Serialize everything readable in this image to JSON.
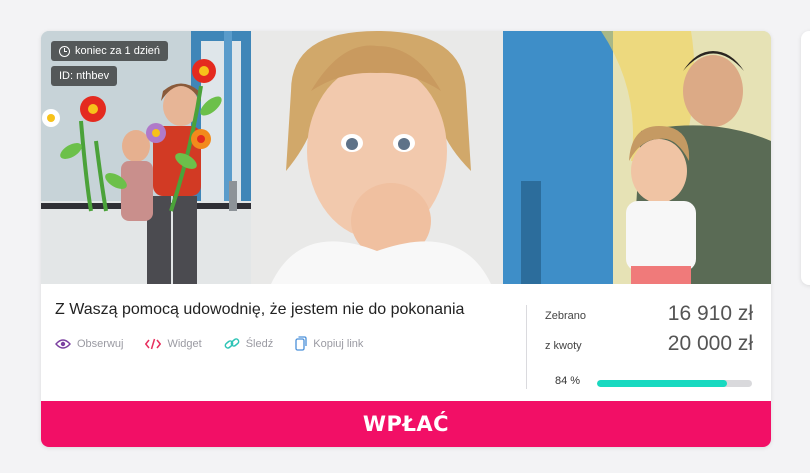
{
  "campaign": {
    "deadline": "koniec za 1 dzień",
    "id_label": "ID: nthbev",
    "title": "Z Waszą pomocą udowodnię, że jestem nie do pokonania",
    "actions": [
      {
        "label": "Obserwuj",
        "icon": "eye-icon"
      },
      {
        "label": "Widget",
        "icon": "code-icon"
      },
      {
        "label": "Śledź",
        "icon": "link-icon"
      },
      {
        "label": "Kopiuj link",
        "icon": "copy-icon"
      }
    ],
    "raised_label": "Zebrano",
    "raised_value": "16 910 zł",
    "goal_label": "z kwoty",
    "goal_value": "20 000 zł",
    "progress_text": "84 %",
    "progress_fraction": 0.84,
    "donate_label": "WPŁAĆ"
  },
  "colors": {
    "accent": "#f20f66",
    "progress": "#18d9c0",
    "eye_icon": "#7b3fa0",
    "code_icon": "#e8305f",
    "link_icon": "#2ec4b6",
    "copy_icon": "#4a90d9"
  }
}
